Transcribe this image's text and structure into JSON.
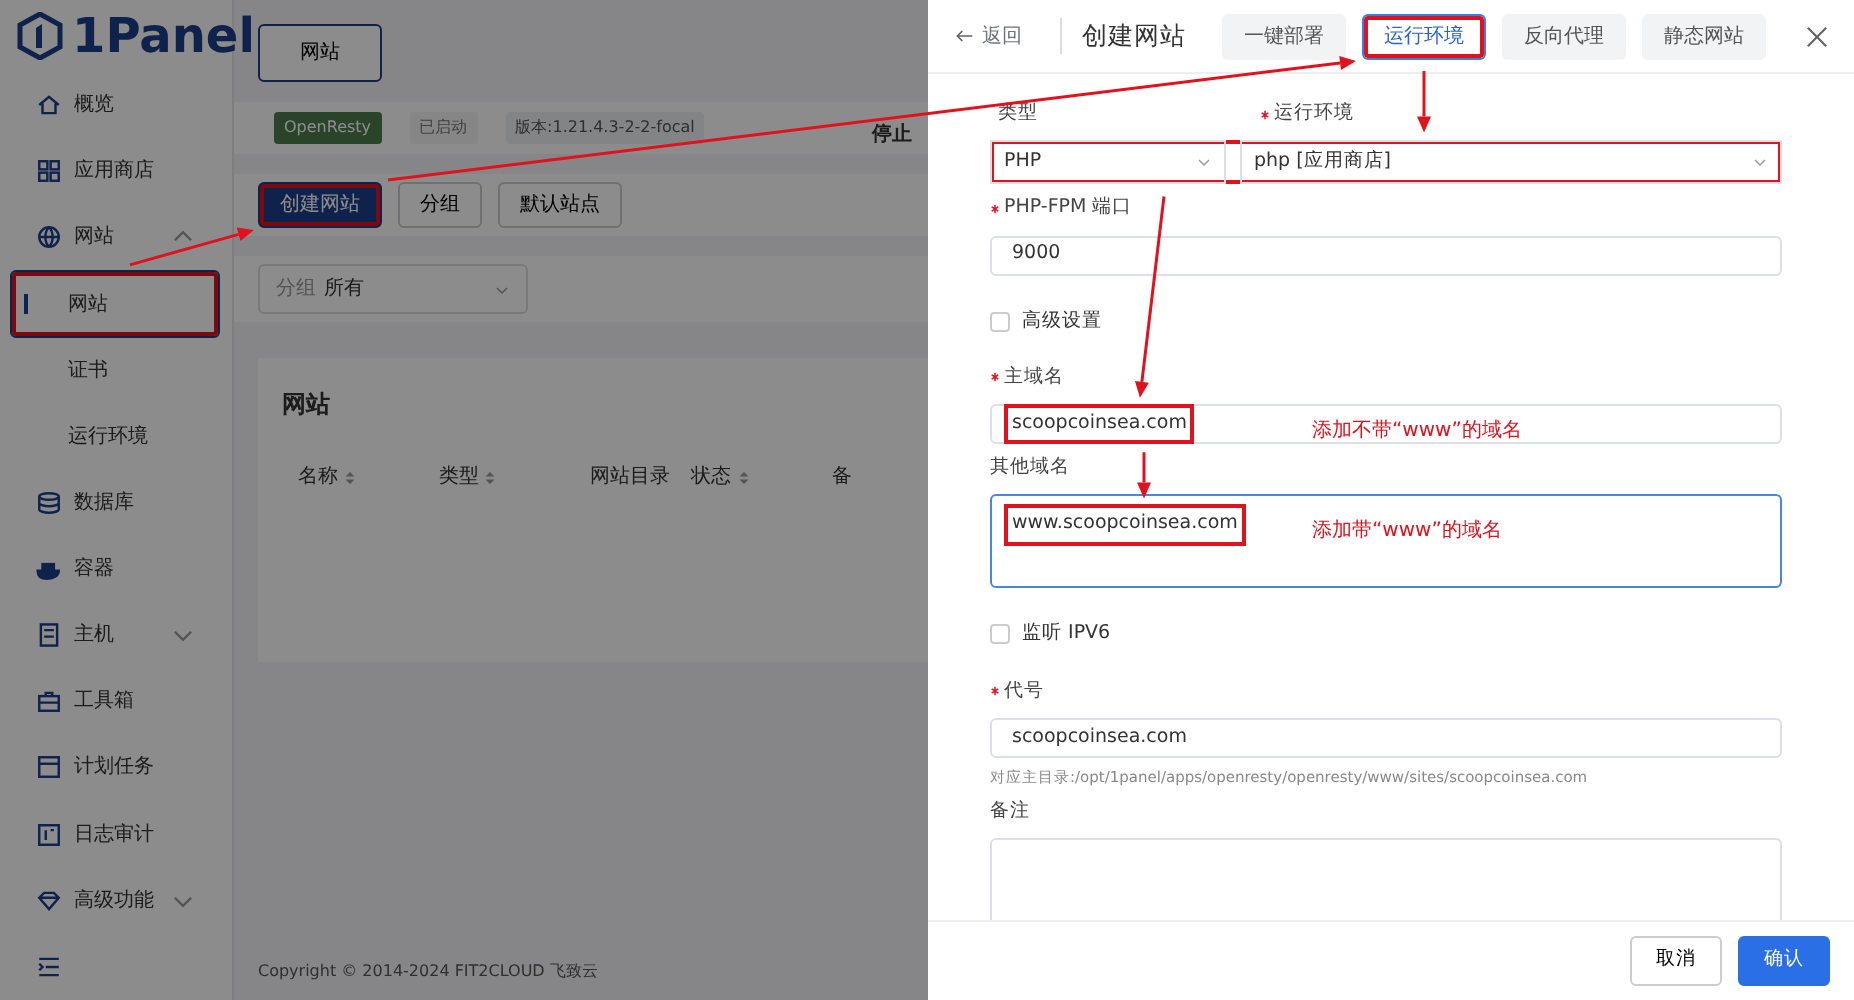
{
  "app": {
    "logo": "1Panel",
    "sidebar": {
      "items": [
        {
          "label": "概览"
        },
        {
          "label": "应用商店"
        },
        {
          "label": "网站",
          "expanded": true,
          "children": [
            {
              "label": "网站",
              "selected": true,
              "highlighted": true
            },
            {
              "label": "证书",
              "selected": false,
              "highlighted": false
            },
            {
              "label": "运行环境",
              "selected": false,
              "highlighted": false
            }
          ]
        },
        {
          "label": "数据库"
        },
        {
          "label": "容器"
        },
        {
          "label": "主机",
          "expanded": false
        },
        {
          "label": "工具箱"
        },
        {
          "label": "计划任务"
        },
        {
          "label": "日志审计"
        },
        {
          "label": "高级功能",
          "expanded": false
        }
      ]
    },
    "page_tab": {
      "label": "网站"
    },
    "status": {
      "badges": [
        {
          "label": "OpenResty",
          "kind": "app"
        },
        {
          "label": "已启动",
          "kind": "state"
        },
        {
          "label": "版本:1.21.4.3-2-2-focal",
          "kind": "version"
        }
      ],
      "action": "停止"
    },
    "toolbar": {
      "buttons": [
        {
          "label": "创建网站",
          "kind": "primary",
          "highlighted": true
        },
        {
          "label": "分组",
          "kind": "default",
          "highlighted": false
        },
        {
          "label": "默认站点",
          "kind": "default",
          "highlighted": false
        }
      ]
    },
    "filter": {
      "label": "分组",
      "value": "所有"
    },
    "table": {
      "title": "网站",
      "columns": [
        {
          "label": "名称",
          "sortable": true
        },
        {
          "label": "类型",
          "sortable": true
        },
        {
          "label": "网站目录",
          "sortable": false
        },
        {
          "label": "状态",
          "sortable": true
        },
        {
          "label": "备",
          "sortable": false
        }
      ]
    },
    "footer": "Copyright © 2014-2024 FIT2CLOUD 飞致云"
  },
  "drawer": {
    "back": "返回",
    "title": "创建网站",
    "tabs": [
      {
        "label": "一键部署",
        "selected": false,
        "highlighted": false
      },
      {
        "label": "运行环境",
        "selected": true,
        "highlighted": true
      },
      {
        "label": "反向代理",
        "selected": false,
        "highlighted": false
      },
      {
        "label": "静态网站",
        "selected": false,
        "highlighted": false
      }
    ],
    "fields": [
      {
        "kind": "select-pair",
        "highlighted": true,
        "items": [
          {
            "label": "类型",
            "required": false,
            "value": "PHP"
          },
          {
            "label": "运行环境",
            "required": true,
            "value": "php [应用商店]"
          }
        ]
      },
      {
        "kind": "input",
        "label": "PHP-FPM 端口",
        "required": true,
        "value": "9000",
        "highlighted": false
      },
      {
        "kind": "checkbox",
        "label": "高级设置",
        "checked": false
      },
      {
        "kind": "input",
        "label": "主域名",
        "required": true,
        "value": "scoopcoinsea.com",
        "highlighted": true,
        "note": "添加不带“www”的域名"
      },
      {
        "kind": "textarea",
        "label": "其他域名",
        "required": false,
        "value": "www.scoopcoinsea.com",
        "highlighted": true,
        "focused": true,
        "note": "添加带“www”的域名"
      },
      {
        "kind": "checkbox",
        "label": "监听 IPV6",
        "checked": false
      },
      {
        "kind": "input",
        "label": "代号",
        "required": true,
        "value": "scoopcoinsea.com",
        "highlighted": false,
        "help": "对应主目录:/opt/1panel/apps/openresty/openresty/www/sites/scoopcoinsea.com"
      },
      {
        "kind": "textarea",
        "label": "备注",
        "required": false,
        "highlighted": false,
        "focused": false
      }
    ],
    "buttons": [
      {
        "label": "取消",
        "kind": "default"
      },
      {
        "label": "确认",
        "kind": "primary"
      }
    ]
  }
}
